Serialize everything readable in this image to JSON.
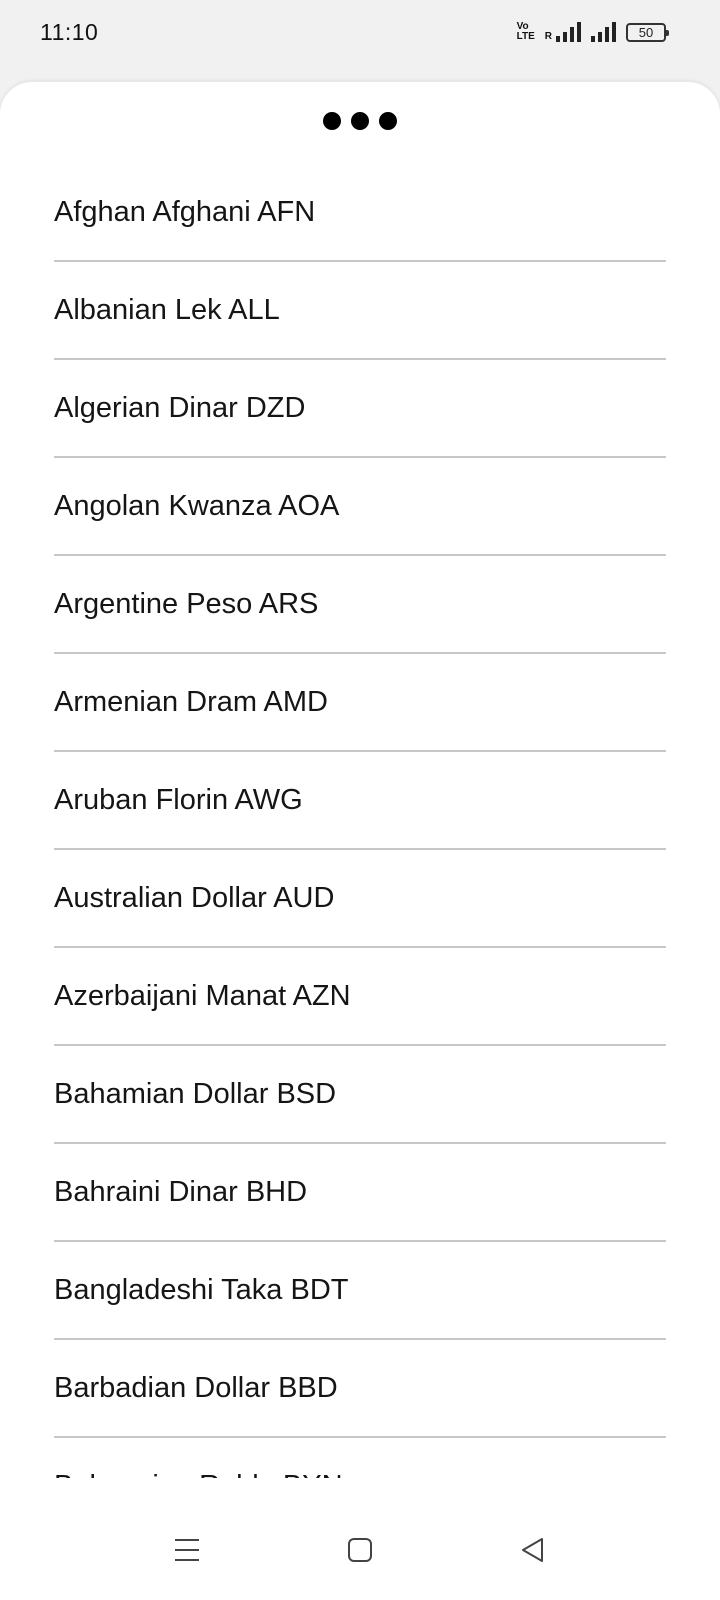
{
  "status_bar": {
    "time": "11:10",
    "volte_top": "Vo",
    "volte_bottom": "LTE",
    "roaming": "R",
    "battery": "50"
  },
  "sheet": {
    "currencies": [
      "Afghan Afghani AFN",
      "Albanian Lek ALL",
      "Algerian Dinar DZD",
      "Angolan Kwanza AOA",
      "Argentine Peso ARS",
      "Armenian Dram AMD",
      "Aruban Florin AWG",
      "Australian Dollar AUD",
      "Azerbaijani Manat AZN",
      "Bahamian Dollar BSD",
      "Bahraini Dinar BHD",
      "Bangladeshi Taka BDT",
      "Barbadian Dollar BBD",
      "Belarusian Ruble BYN"
    ]
  },
  "colors": {
    "divider": "#c8c8c8",
    "text": "#151515",
    "background": "#ffffff"
  }
}
